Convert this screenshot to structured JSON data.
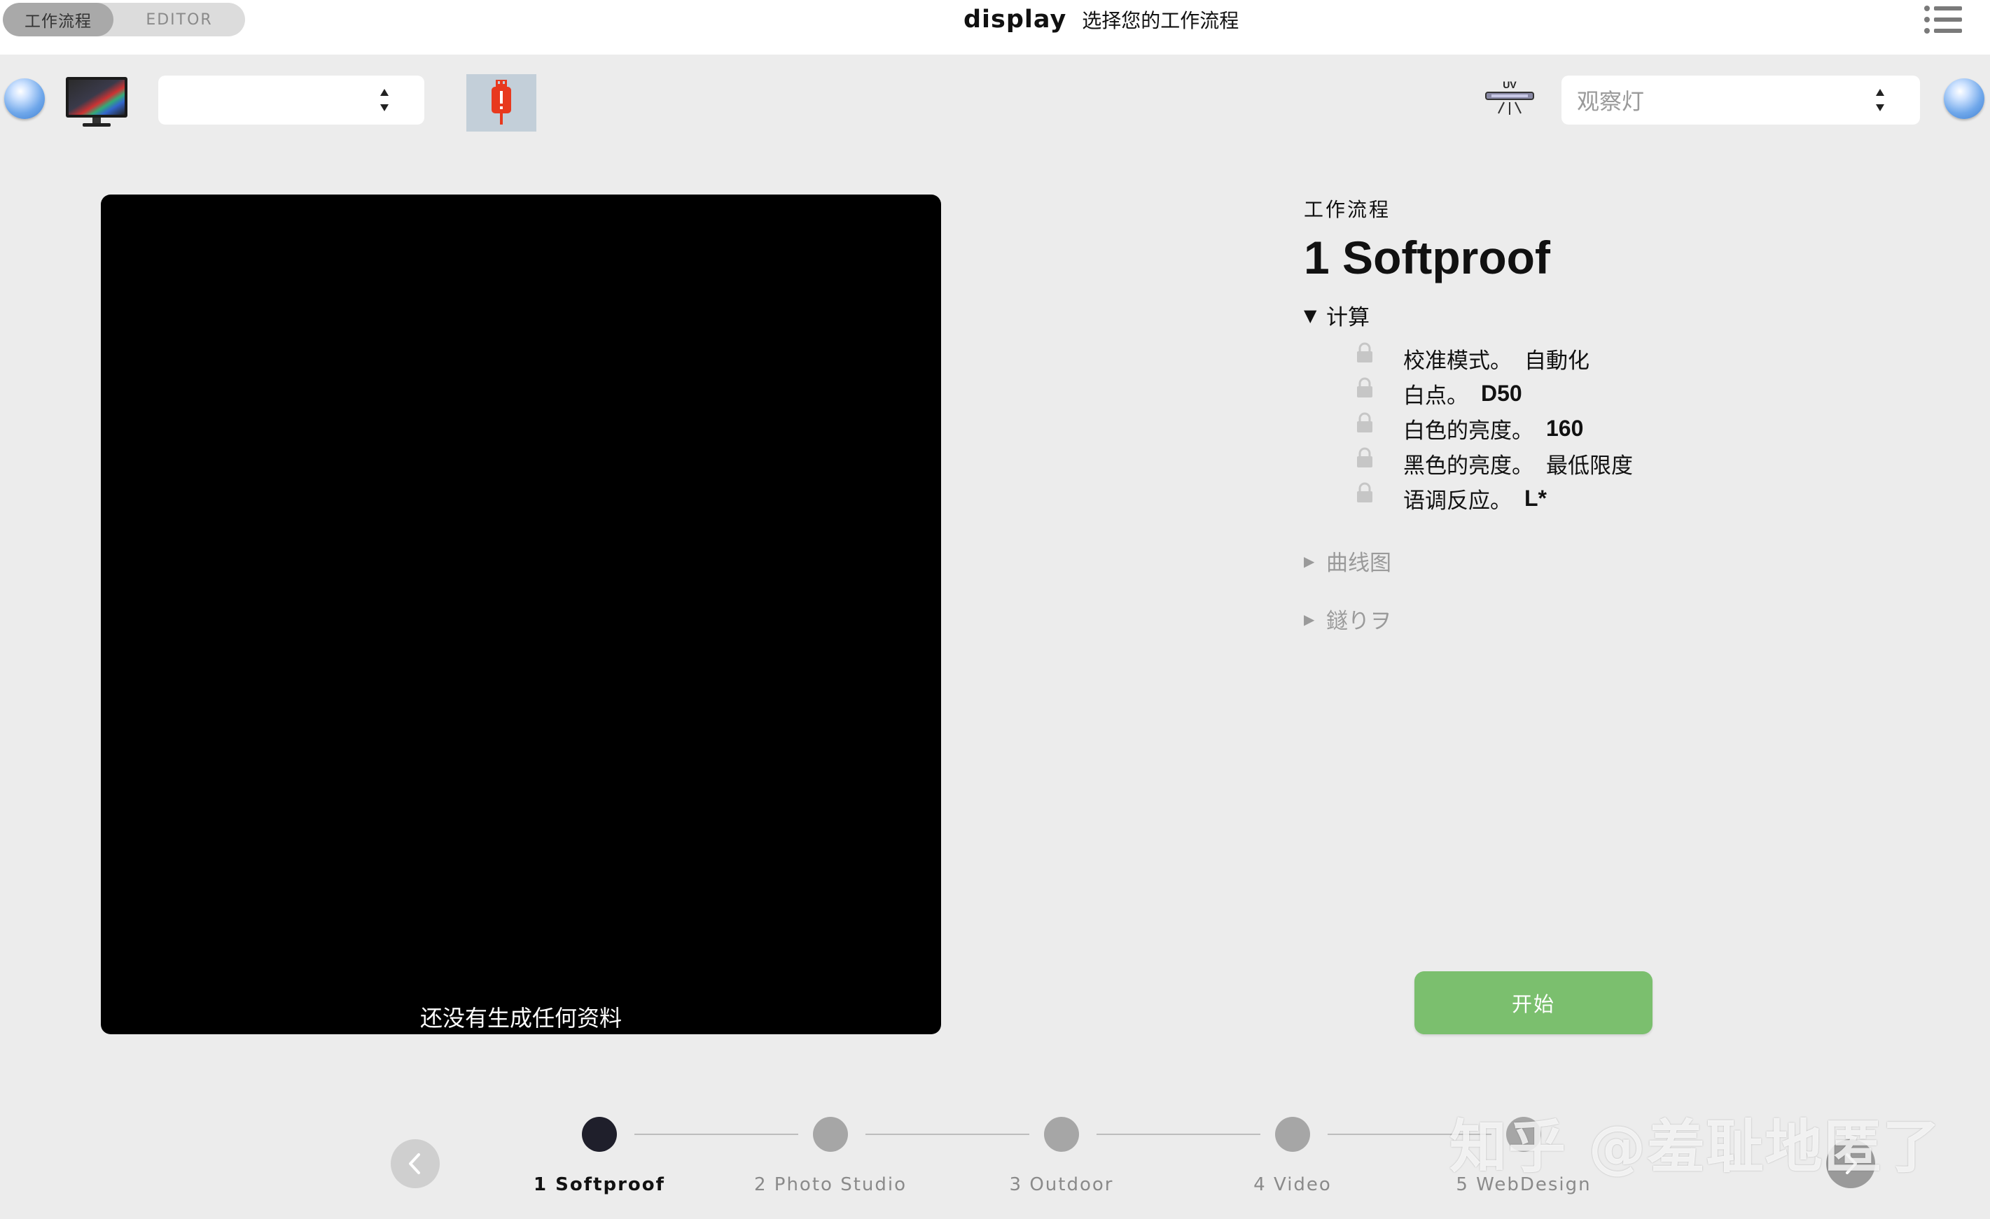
{
  "header": {
    "mode_workflow": "工作流程",
    "mode_editor": "EDITOR",
    "app_name": "display",
    "subtitle": "选择您的工作流程"
  },
  "device_row": {
    "display_select_value": "",
    "light_select_placeholder": "观察灯",
    "usb_status_icon": "usb-warning-icon",
    "uv_icon": "uv-light-icon"
  },
  "preview": {
    "message": "还没有生成任何资料"
  },
  "workflow": {
    "eyebrow": "工作流程",
    "title": "1 Softproof",
    "sections": {
      "calc": "计算",
      "curves": "曲线图",
      "other": "鐩りヲ"
    },
    "params": [
      {
        "label": "校准模式。",
        "value": "自動化"
      },
      {
        "label": "白点。",
        "value": "D50"
      },
      {
        "label": "白色的亮度。",
        "value": "160"
      },
      {
        "label": "黑色的亮度。",
        "value": "最低限度"
      },
      {
        "label": "语调反应。",
        "value": "L*"
      }
    ]
  },
  "start_button": "开始",
  "steps": [
    {
      "label": "1 Softproof"
    },
    {
      "label": "2 Photo Studio"
    },
    {
      "label": "3 Outdoor"
    },
    {
      "label": "4 Video"
    },
    {
      "label": "5 WebDesign"
    }
  ],
  "watermark": "知乎 @羞耻地匿了",
  "colors": {
    "accent_green": "#7bbf6e",
    "active_step": "#1f1f2b",
    "inactive_step": "#a6a6a6",
    "usb_alert": "#e8391e"
  }
}
